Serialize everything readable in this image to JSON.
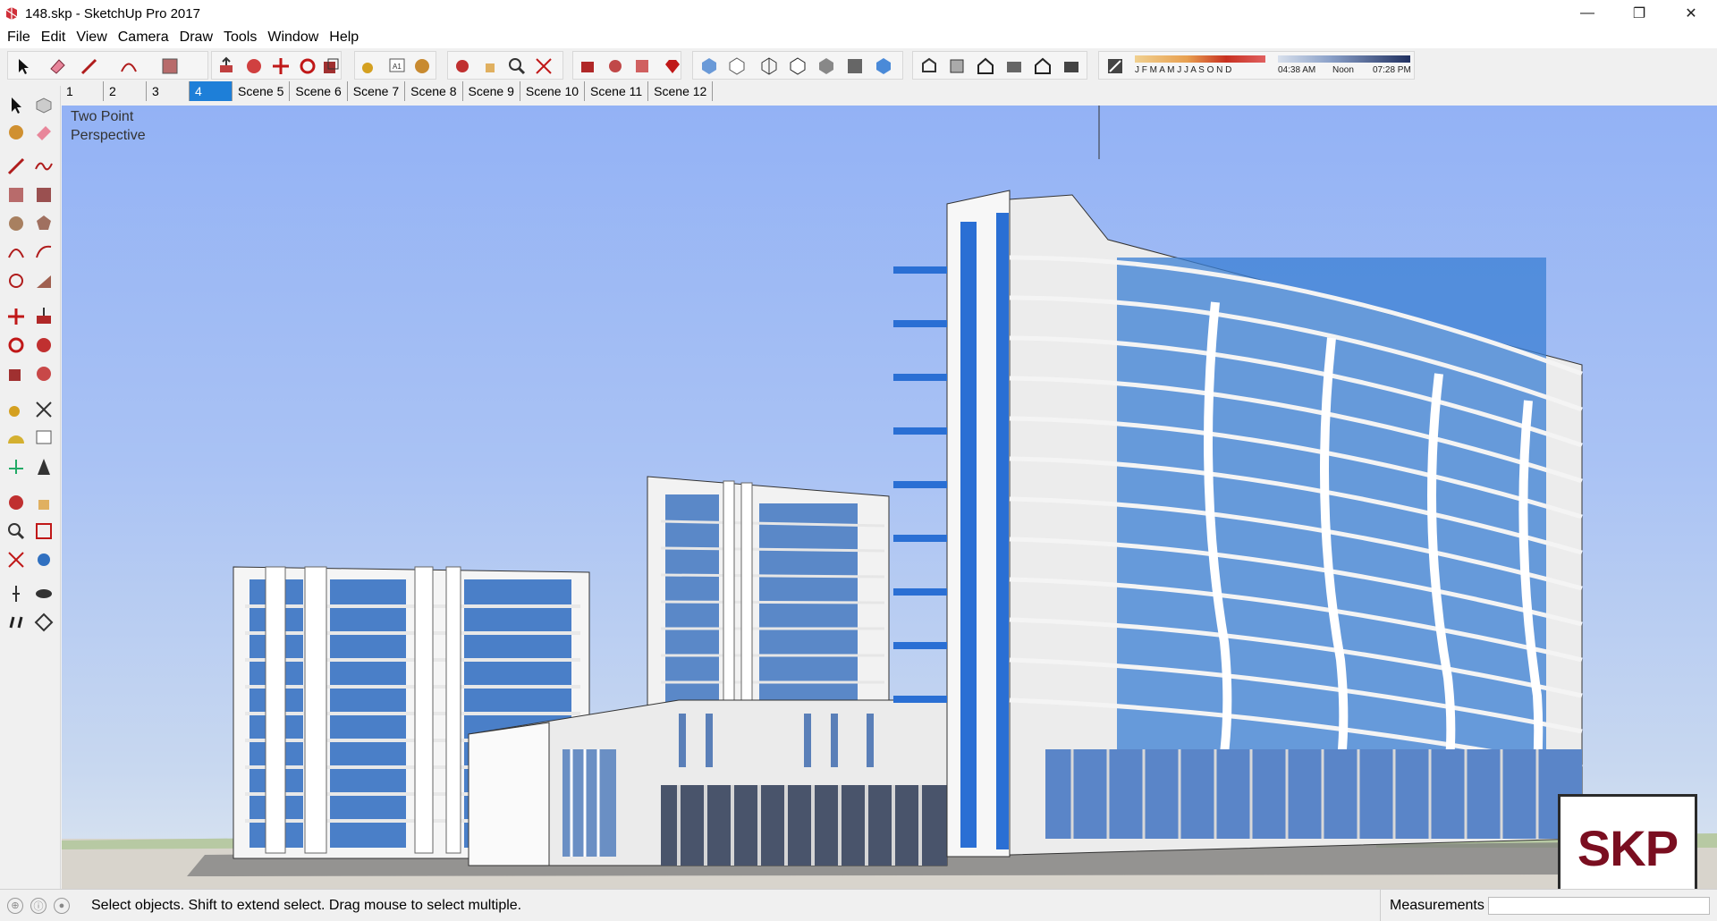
{
  "window": {
    "title": "148.skp - SketchUp Pro 2017",
    "controls": {
      "minimize": "—",
      "restore": "❐",
      "close": "✕"
    }
  },
  "menu": [
    "File",
    "Edit",
    "View",
    "Camera",
    "Draw",
    "Tools",
    "Window",
    "Help"
  ],
  "toolbar": {
    "shadow_months": "J F M A M J J A S O N D",
    "time_start": "04:38 AM",
    "time_mid": "Noon",
    "time_end": "07:28 PM"
  },
  "scenes": {
    "tabs": [
      "1",
      "2",
      "3",
      "4",
      "Scene 5",
      "Scene 6",
      "Scene 7",
      "Scene 8",
      "Scene 9",
      "Scene 10",
      "Scene 11",
      "Scene 12"
    ],
    "active_index": 3
  },
  "viewport": {
    "label_line1": "Two Point",
    "label_line2": "Perspective",
    "logo_text": "SKP",
    "sky_color": "#93b2f5",
    "glass_color": "#3a7fd4"
  },
  "status": {
    "message": "Select objects. Shift to extend select. Drag mouse to select multiple.",
    "measurements_label": "Measurements",
    "measurements_value": ""
  }
}
